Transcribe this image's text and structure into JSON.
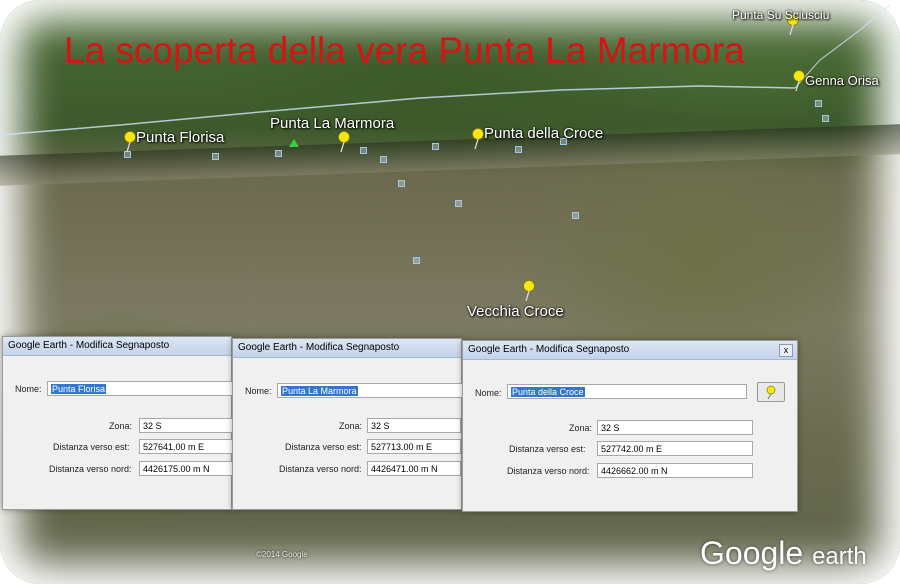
{
  "title": "La scoperta della vera Punta La Marmora",
  "places": {
    "punta_su_sciusciu": "Punta Su Sciusciu",
    "genna_orisa": "Genna Orisa",
    "punta_florisa": "Punta Florisa",
    "punta_la_marmora": "Punta La Marmora",
    "punta_della_croce": "Punta della Croce",
    "vecchia_croce": "Vecchia Croce"
  },
  "dialogs": [
    {
      "title": "Google Earth - Modifica Segnaposto",
      "nome_label": "Nome:",
      "nome": "Punta Florisa",
      "zona_label": "Zona:",
      "zona": "32 S",
      "est_label": "Distanza verso est:",
      "est": "527641.00 m E",
      "nord_label": "Distanza verso nord:",
      "nord": "4426175.00 m N"
    },
    {
      "title": "Google Earth - Modifica Segnaposto",
      "nome_label": "Nome:",
      "nome": "Punta La Marmora",
      "zona_label": "Zona:",
      "zona": "32 S",
      "est_label": "Distanza verso est:",
      "est": "527713.00 m E",
      "nord_label": "Distanza verso nord:",
      "nord": "4426471.00 m N"
    },
    {
      "title": "Google Earth - Modifica Segnaposto",
      "nome_label": "Nome:",
      "nome": "Punta della Croce",
      "zona_label": "Zona:",
      "zona": "32 S",
      "est_label": "Distanza verso est:",
      "est": "527742.00 m E",
      "nord_label": "Distanza verso nord:",
      "nord": "4426662.00 m N",
      "close": "x"
    }
  ],
  "copyright": "©2014 Google",
  "brand": {
    "google": "Google",
    "earth": "earth"
  },
  "colors": {
    "title": "#d51414",
    "pin": "#f5e614",
    "selection": "#3377cc"
  },
  "icons": [
    "pushpin-icon",
    "close-icon"
  ]
}
